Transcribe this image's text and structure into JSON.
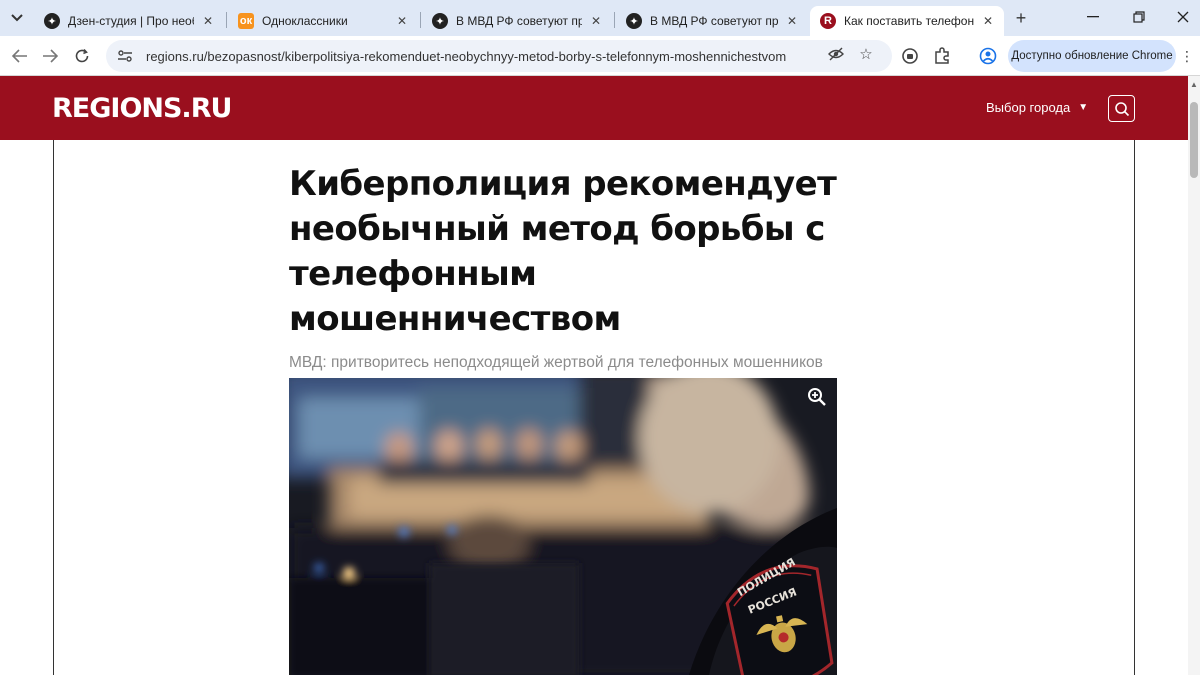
{
  "browser": {
    "tabs": [
      {
        "title": "Дзен-студия | Про необычн",
        "favicon": "dzen-icon",
        "active": false
      },
      {
        "title": "Одноклассники",
        "favicon": "odnoklassniki-icon",
        "active": false
      },
      {
        "title": "В МВД РФ советуют притво",
        "favicon": "dzen-icon",
        "active": false
      },
      {
        "title": "В МВД РФ советуют притво",
        "favicon": "dzen-icon",
        "active": false
      },
      {
        "title": "Как поставить телефонных",
        "favicon": "regions-icon",
        "active": true
      }
    ],
    "url": "regions.ru/bezopasnost/kiberpolitsiya-rekomenduet-neobychnyy-metod-borby-s-telefonnym-moshennichestvom",
    "update_label": "Доступно обновление Chrome"
  },
  "site": {
    "logo": "REGIONS.RU",
    "city_select": "Выбор города",
    "brand_color": "#9a0f1e"
  },
  "article": {
    "headline": "Киберполиция рекомендует необычный метод борьбы с телефонным мошенничеством",
    "subtitle": "МВД: притворитесь неподходящей жертвой для телефонных мошенников",
    "photo_patch_text": "ПОЛИЦИЯ РОССИЯ"
  }
}
